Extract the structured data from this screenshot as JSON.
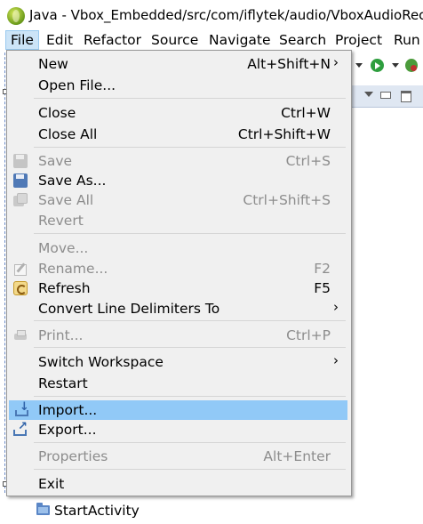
{
  "window": {
    "title": "Java - Vbox_Embedded/src/com/iflytek/audio/VboxAudioRec"
  },
  "menubar": {
    "items": [
      "File",
      "Edit",
      "Refactor",
      "Source",
      "Navigate",
      "Search",
      "Project",
      "Run"
    ],
    "active": "File"
  },
  "file_menu": {
    "items": [
      {
        "label": "New",
        "accelerator": "Alt+Shift+N",
        "submenu": true,
        "enabled": true
      },
      {
        "label": "Open File...",
        "enabled": true
      },
      {
        "label": "Close",
        "accelerator": "Ctrl+W",
        "enabled": true
      },
      {
        "label": "Close All",
        "accelerator": "Ctrl+Shift+W",
        "enabled": true
      },
      {
        "label": "Save",
        "accelerator": "Ctrl+S",
        "enabled": false,
        "icon": "save-icon"
      },
      {
        "label": "Save As...",
        "enabled": true,
        "icon": "save-as-icon"
      },
      {
        "label": "Save All",
        "accelerator": "Ctrl+Shift+S",
        "enabled": false,
        "icon": "save-all-icon"
      },
      {
        "label": "Revert",
        "enabled": false
      },
      {
        "label": "Move...",
        "enabled": false
      },
      {
        "label": "Rename...",
        "accelerator": "F2",
        "enabled": false,
        "icon": "rename-icon"
      },
      {
        "label": "Refresh",
        "accelerator": "F5",
        "enabled": true,
        "icon": "refresh-icon"
      },
      {
        "label": "Convert Line Delimiters To",
        "submenu": true,
        "enabled": true
      },
      {
        "label": "Print...",
        "accelerator": "Ctrl+P",
        "enabled": false,
        "icon": "print-icon"
      },
      {
        "label": "Switch Workspace",
        "submenu": true,
        "enabled": true
      },
      {
        "label": "Restart",
        "enabled": true
      },
      {
        "label": "Import...",
        "enabled": true,
        "highlighted": true,
        "icon": "import-icon"
      },
      {
        "label": "Export...",
        "enabled": true,
        "icon": "export-icon"
      },
      {
        "label": "Properties",
        "accelerator": "Alt+Enter",
        "enabled": false
      },
      {
        "label": "Exit",
        "enabled": true
      }
    ]
  },
  "tree": {
    "visible_item": "StartActivity"
  },
  "colors": {
    "highlight": "#91c9f7",
    "menu_background": "#f0f0f0",
    "disabled_text": "#8d8d8d",
    "active_menubar": "#cce4f7"
  }
}
